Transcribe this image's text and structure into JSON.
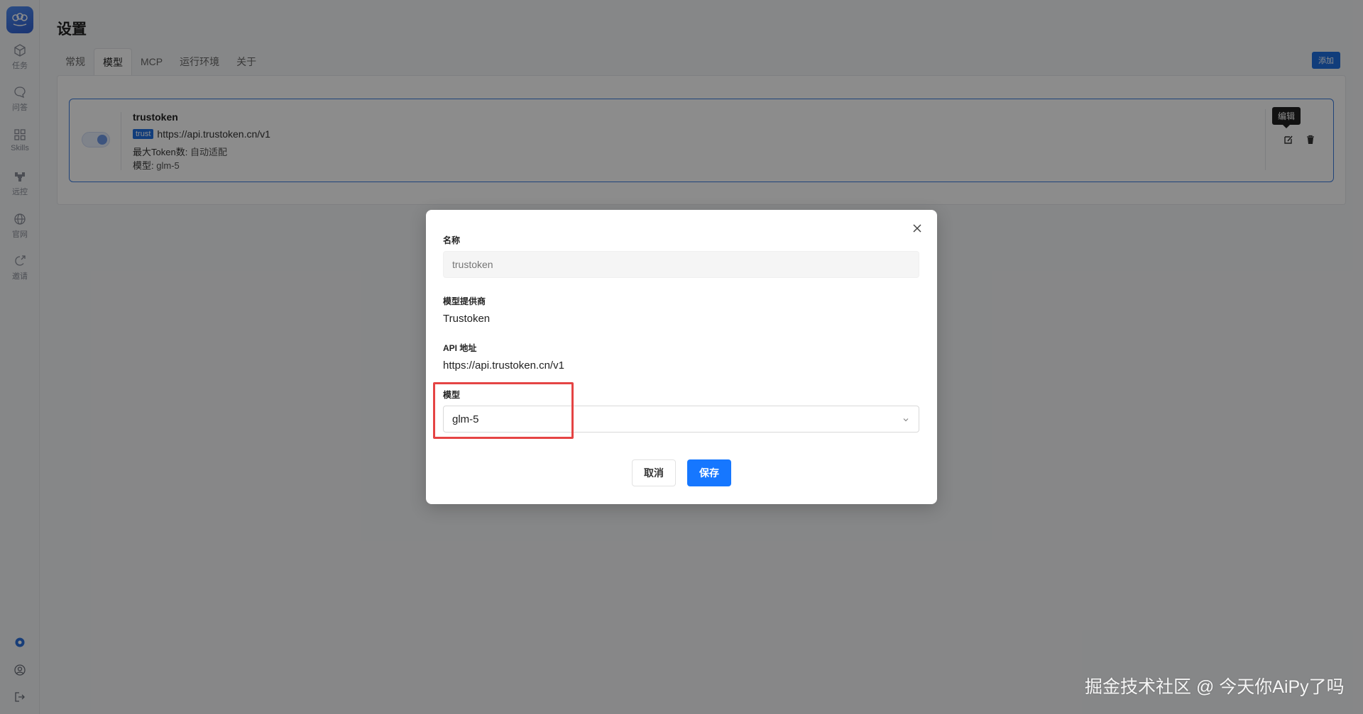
{
  "sidebar": {
    "logo": "logo-icon",
    "items": [
      {
        "label": "任务",
        "icon": "cube-icon"
      },
      {
        "label": "问答",
        "icon": "chat-icon"
      },
      {
        "label": "Skills",
        "icon": "grid-icon"
      },
      {
        "label": "远控",
        "icon": "remote-icon"
      },
      {
        "label": "官网",
        "icon": "globe-icon"
      },
      {
        "label": "邀请",
        "icon": "invite-icon"
      }
    ],
    "bottom": [
      "settings-icon",
      "user-icon",
      "logout-icon"
    ]
  },
  "page": {
    "title": "设置",
    "tabs": [
      "常规",
      "模型",
      "MCP",
      "运行环境",
      "关于"
    ],
    "active_tab": "模型",
    "add_label": "添加"
  },
  "card": {
    "name": "trustoken",
    "tag": "trust",
    "url": "https://api.trustoken.cn/v1",
    "max_token_key": "最大Token数:",
    "max_token_val": "自动适配",
    "model_key": "模型:",
    "model_val": "glm-5",
    "enabled": true,
    "tooltip": "编辑"
  },
  "modal": {
    "name_label": "名称",
    "name_placeholder": "trustoken",
    "provider_label": "模型提供商",
    "provider_value": "Trustoken",
    "api_label": "API 地址",
    "api_value": "https://api.trustoken.cn/v1",
    "model_label": "模型",
    "model_value": "glm-5",
    "cancel_label": "取消",
    "save_label": "保存"
  },
  "watermark": "掘金技术社区 @ 今天你AiPy了吗",
  "colors": {
    "accent": "#1677ff",
    "highlight": "#e54444",
    "card_border": "#3a7bde"
  }
}
